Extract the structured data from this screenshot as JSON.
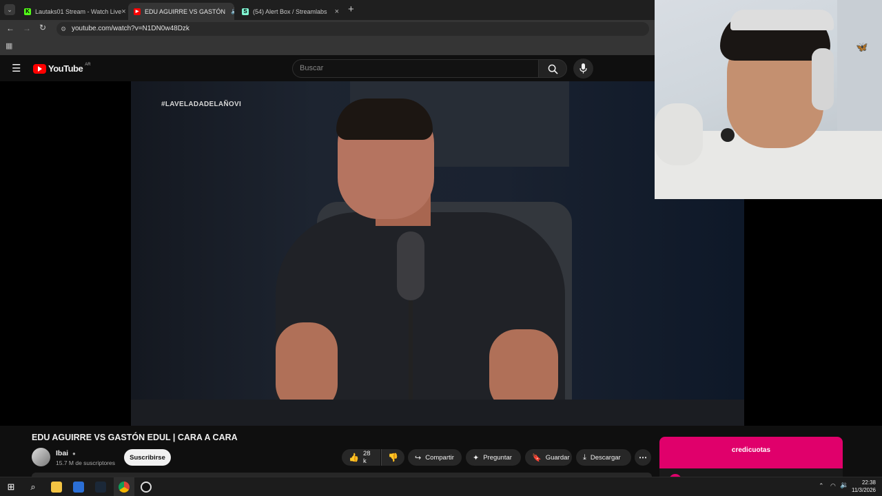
{
  "browser": {
    "tabs": [
      {
        "label": "Lautaks01 Stream - Watch Live",
        "favicon": "kick-icon"
      },
      {
        "label": "EDU AGUIRRE VS GASTÓN",
        "favicon": "youtube-icon"
      },
      {
        "label": "(54) Alert Box / Streamlabs",
        "favicon": "streamlabs-icon"
      }
    ],
    "url": "youtube.com/watch?v=N1DN0w48Dzk"
  },
  "youtube": {
    "logo": "YouTube",
    "region": "AR",
    "search_placeholder": "Buscar"
  },
  "video": {
    "overlay_hashtag": "#LAVELADADELAÑOVI",
    "title": "EDU AGUIRRE VS GASTÓN EDUL | CARA A CARA",
    "channel": {
      "name": "Ibai",
      "subscribers": "15.7 M de suscriptores",
      "subscribe_label": "Suscribirse"
    },
    "actions": {
      "likes": "28 k",
      "share": "Compartir",
      "ask": "Preguntar",
      "save": "Guardar",
      "download": "Descargar"
    }
  },
  "overlay": {
    "brand": "credicuotas"
  },
  "taskbar": {
    "time": "22:38",
    "date": "11/3/2026"
  },
  "colors": {
    "youtube_red": "#ff0000",
    "credicuotas_pink": "#e0006b"
  }
}
